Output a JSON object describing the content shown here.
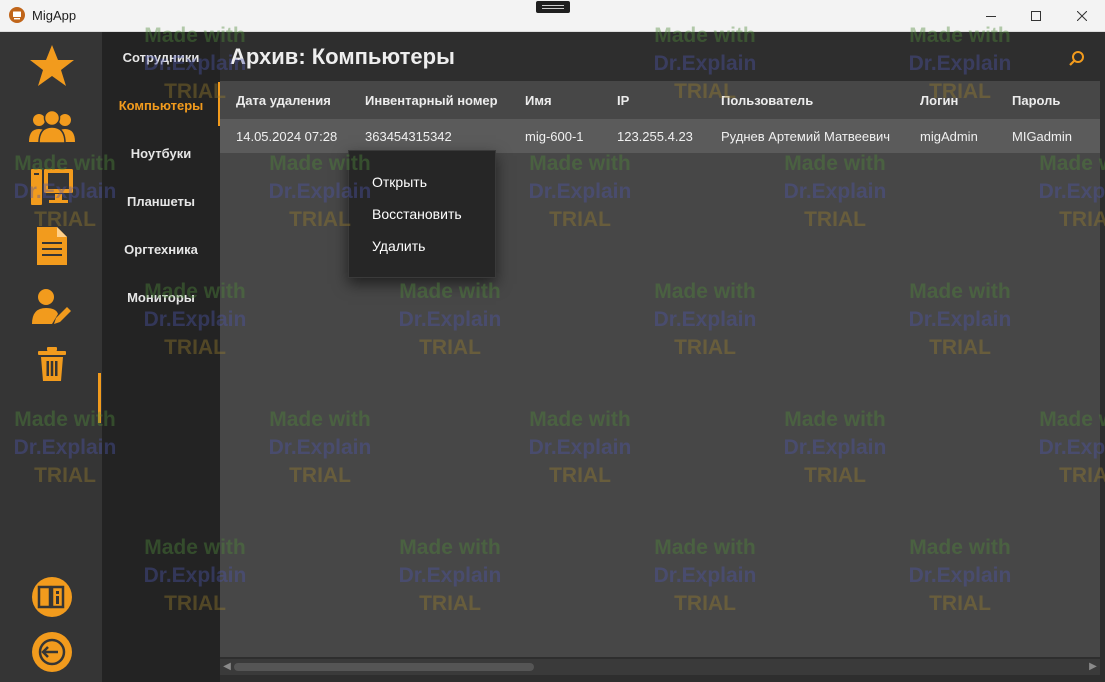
{
  "window": {
    "title": "MigApp"
  },
  "rail": {
    "items": [
      "favorites",
      "employees",
      "computers",
      "documents",
      "users-edit",
      "trash"
    ],
    "bottom": [
      "help",
      "logout"
    ]
  },
  "colors": {
    "accent": "#f29b1d",
    "rail_bg": "#353535",
    "subnav_bg": "#232323",
    "grid_bg": "#474747",
    "row_selected": "#5b5b5b"
  },
  "subnav": {
    "items": [
      {
        "label": "Сотрудники"
      },
      {
        "label": "Компьютеры"
      },
      {
        "label": "Ноутбуки"
      },
      {
        "label": "Планшеты"
      },
      {
        "label": "Оргтехника"
      },
      {
        "label": "Мониторы"
      }
    ],
    "active": "Компьютеры"
  },
  "page": {
    "title": "Архив: Компьютеры"
  },
  "table": {
    "columns": [
      "Дата удаления",
      "Инвентарный номер",
      "Имя",
      "IP",
      "Пользователь",
      "Логин",
      "Пароль"
    ],
    "rows": [
      [
        "14.05.2024 07:28",
        "363454315342",
        "mig-600-1",
        "123.255.4.23",
        "Руднев Артемий Матвеевич",
        "migAdmin",
        "MIGadmin"
      ]
    ]
  },
  "context_menu": {
    "items": [
      "Открыть",
      "Восстановить",
      "Удалить"
    ]
  },
  "watermark": {
    "line1": "Made with",
    "line2": "Dr.Explain",
    "line3": "TRIAL"
  }
}
